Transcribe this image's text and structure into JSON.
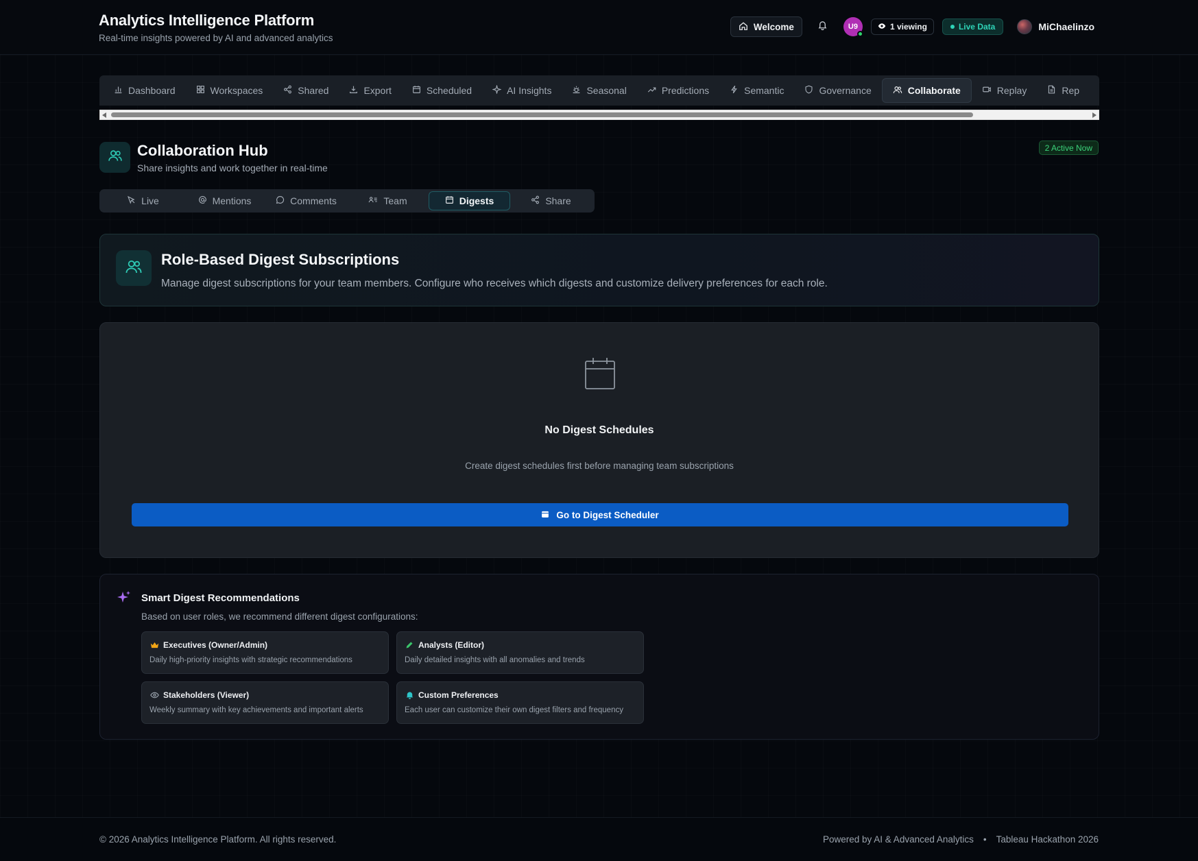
{
  "app": {
    "title": "Analytics Intelligence Platform",
    "subtitle": "Real-time insights powered by AI and advanced analytics"
  },
  "header": {
    "welcome_label": "Welcome",
    "user_initials": "U9",
    "viewing_label": "1 viewing",
    "live_label": "Live Data",
    "username": "MiChaelinzo"
  },
  "nav": {
    "items": [
      {
        "label": "Dashboard",
        "icon": "bar-chart-icon"
      },
      {
        "label": "Workspaces",
        "icon": "grid-icon"
      },
      {
        "label": "Shared",
        "icon": "share-icon"
      },
      {
        "label": "Export",
        "icon": "download-icon"
      },
      {
        "label": "Scheduled",
        "icon": "calendar-icon"
      },
      {
        "label": "AI Insights",
        "icon": "sparkle-icon"
      },
      {
        "label": "Seasonal",
        "icon": "sun-icon"
      },
      {
        "label": "Predictions",
        "icon": "trend-up-icon"
      },
      {
        "label": "Semantic",
        "icon": "lightning-icon"
      },
      {
        "label": "Governance",
        "icon": "shield-icon"
      },
      {
        "label": "Collaborate",
        "icon": "users-icon",
        "active": true
      },
      {
        "label": "Replay",
        "icon": "video-icon"
      },
      {
        "label": "Rep",
        "icon": "file-icon"
      }
    ]
  },
  "hub": {
    "title": "Collaboration Hub",
    "subtitle": "Share insights and work together in real-time",
    "active_now": "2 Active Now",
    "tabs": [
      {
        "label": "Live",
        "icon": "cursor-icon"
      },
      {
        "label": "Mentions",
        "icon": "at-icon"
      },
      {
        "label": "Comments",
        "icon": "chat-icon"
      },
      {
        "label": "Team",
        "icon": "team-list-icon"
      },
      {
        "label": "Digests",
        "icon": "calendar-icon",
        "active": true
      },
      {
        "label": "Share",
        "icon": "share-icon"
      }
    ]
  },
  "role_card": {
    "title": "Role-Based Digest Subscriptions",
    "description": "Manage digest subscriptions for your team members. Configure who receives which digests and customize delivery preferences for each role."
  },
  "empty_state": {
    "title": "No Digest Schedules",
    "message": "Create digest schedules first before managing team subscriptions",
    "button_label": "Go to Digest Scheduler"
  },
  "smart": {
    "title": "Smart Digest Recommendations",
    "subtitle": "Based on user roles, we recommend different digest configurations:",
    "recommendations": [
      {
        "title": "Executives (Owner/Admin)",
        "description": "Daily high-priority insights with strategic recommendations",
        "icon": "crown-icon",
        "color": "#f2a516"
      },
      {
        "title": "Analysts (Editor)",
        "description": "Daily detailed insights with all anomalies and trends",
        "icon": "pencil-icon",
        "color": "#3bc46a"
      },
      {
        "title": "Stakeholders (Viewer)",
        "description": "Weekly summary with key achievements and important alerts",
        "icon": "eye-icon",
        "color": "#9aa3ad"
      },
      {
        "title": "Custom Preferences",
        "description": "Each user can customize their own digest filters and frequency",
        "icon": "bell-icon",
        "color": "#2ec4c8"
      }
    ]
  },
  "footer": {
    "copyright": "© 2026 Analytics Intelligence Platform. All rights reserved.",
    "powered": "Powered by AI & Advanced Analytics",
    "separator": "•",
    "event": "Tableau Hackathon 2026"
  },
  "colors": {
    "accent_teal": "#2ed3b7",
    "primary_blue": "#0b5cc4",
    "active_green": "#3bd27a",
    "avatar_magenta": "#b02fb4"
  }
}
